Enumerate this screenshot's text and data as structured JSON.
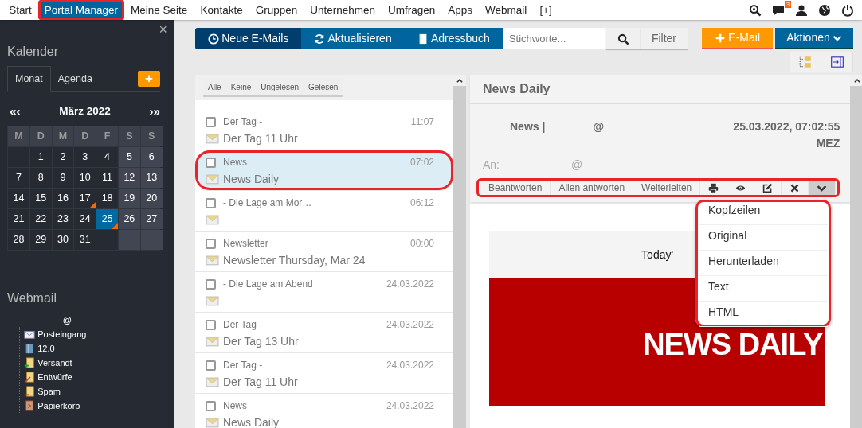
{
  "topnav": {
    "items": [
      {
        "label": "Start",
        "selected": false,
        "highlighted": false
      },
      {
        "label": "Portal Manager",
        "selected": true,
        "highlighted": true
      },
      {
        "label": "Meine Seite",
        "selected": false,
        "highlighted": false
      },
      {
        "label": "Kontakte",
        "selected": false,
        "highlighted": false
      },
      {
        "label": "Gruppen",
        "selected": false,
        "highlighted": false
      },
      {
        "label": "Unternehmen",
        "selected": false,
        "highlighted": false
      },
      {
        "label": "Umfragen",
        "selected": false,
        "highlighted": false
      },
      {
        "label": "Apps",
        "selected": false,
        "highlighted": false
      },
      {
        "label": "Webmail",
        "selected": false,
        "highlighted": false
      },
      {
        "label": "[+]",
        "selected": false,
        "highlighted": false
      }
    ],
    "icons": [
      {
        "kind": "zoom"
      },
      {
        "kind": "chat",
        "badge": "3"
      },
      {
        "kind": "user"
      },
      {
        "kind": "globe"
      },
      {
        "kind": "power"
      }
    ]
  },
  "sidebar": {
    "close": "×",
    "calendar": {
      "title": "Kalender",
      "tabs": [
        {
          "label": "Monat",
          "selected": true
        },
        {
          "label": "Agenda",
          "selected": false
        }
      ],
      "add": "+",
      "prev": "«‹",
      "month": "März 2022",
      "next": "›»",
      "weekdays": [
        "M",
        "D",
        "M",
        "D",
        "F",
        "S",
        "S"
      ],
      "days": [
        {
          "kind": "blank"
        },
        {
          "kind": "day",
          "label": "1",
          "selected": false,
          "marked": false
        },
        {
          "kind": "day",
          "label": "2",
          "selected": false,
          "marked": false
        },
        {
          "kind": "day",
          "label": "3",
          "selected": false,
          "marked": false
        },
        {
          "kind": "day",
          "label": "4",
          "selected": false,
          "marked": false
        },
        {
          "kind": "day",
          "label": "5",
          "selected": false,
          "marked": false
        },
        {
          "kind": "day",
          "label": "6",
          "selected": false,
          "marked": false
        },
        {
          "kind": "day",
          "label": "7",
          "selected": false,
          "marked": false
        },
        {
          "kind": "day",
          "label": "8",
          "selected": false,
          "marked": false
        },
        {
          "kind": "day",
          "label": "9",
          "selected": false,
          "marked": false
        },
        {
          "kind": "day",
          "label": "10",
          "selected": false,
          "marked": false
        },
        {
          "kind": "day",
          "label": "11",
          "selected": false,
          "marked": false
        },
        {
          "kind": "day",
          "label": "12",
          "selected": false,
          "marked": false
        },
        {
          "kind": "day",
          "label": "13",
          "selected": false,
          "marked": false
        },
        {
          "kind": "day",
          "label": "14",
          "selected": false,
          "marked": false
        },
        {
          "kind": "day",
          "label": "15",
          "selected": false,
          "marked": false
        },
        {
          "kind": "day",
          "label": "16",
          "selected": false,
          "marked": false
        },
        {
          "kind": "day",
          "label": "17",
          "selected": false,
          "marked": true
        },
        {
          "kind": "day",
          "label": "18",
          "selected": false,
          "marked": false
        },
        {
          "kind": "day",
          "label": "19",
          "selected": false,
          "marked": false
        },
        {
          "kind": "day",
          "label": "20",
          "selected": false,
          "marked": false
        },
        {
          "kind": "day",
          "label": "21",
          "selected": false,
          "marked": false
        },
        {
          "kind": "day",
          "label": "22",
          "selected": false,
          "marked": false
        },
        {
          "kind": "day",
          "label": "23",
          "selected": false,
          "marked": false
        },
        {
          "kind": "day",
          "label": "24",
          "selected": false,
          "marked": false
        },
        {
          "kind": "day",
          "label": "25",
          "selected": true,
          "marked": true
        },
        {
          "kind": "day",
          "label": "26",
          "selected": false,
          "marked": false
        },
        {
          "kind": "day",
          "label": "27",
          "selected": false,
          "marked": false
        },
        {
          "kind": "day",
          "label": "28",
          "selected": false,
          "marked": false
        },
        {
          "kind": "day",
          "label": "29",
          "selected": false,
          "marked": false
        },
        {
          "kind": "day",
          "label": "30",
          "selected": false,
          "marked": false
        },
        {
          "kind": "day",
          "label": "31",
          "selected": false,
          "marked": false
        },
        {
          "kind": "blank"
        },
        {
          "kind": "blank"
        },
        {
          "kind": "blank"
        }
      ]
    },
    "webmail": {
      "title": "Webmail",
      "account": "@",
      "folders": [
        {
          "label": "Posteingang",
          "kind": "inbox"
        },
        {
          "label": "12.0",
          "kind": "book"
        },
        {
          "label": "Versandt",
          "kind": "sent"
        },
        {
          "label": "Entwürfe",
          "kind": "drafts"
        },
        {
          "label": "Spam",
          "kind": "spam"
        },
        {
          "label": "Papierkorb",
          "kind": "trash"
        }
      ]
    }
  },
  "toolbar": {
    "buttons": [
      {
        "label": "Neue E-Mails",
        "selected": true
      },
      {
        "label": "Aktualisieren",
        "selected": false
      },
      {
        "label": "Adressbuch",
        "selected": false
      }
    ],
    "search": {
      "placeholder": "Stichworte..."
    },
    "filter": "Filter",
    "new_mail": "E-Mail",
    "actions": "Aktionen",
    "view_icons": [
      {
        "kind": "tree"
      },
      {
        "kind": "panel"
      }
    ]
  },
  "mail_list": {
    "filters": [
      "Alle",
      "Keine",
      "Ungelesen",
      "Gelesen"
    ],
    "items": [
      {
        "sender": "Der Tag -",
        "time": "11:07",
        "subject": "Der Tag 11 Uhr",
        "selected": false,
        "highlighted": false
      },
      {
        "sender": "News",
        "time": "07:02",
        "subject": "News Daily",
        "selected": true,
        "highlighted": true
      },
      {
        "sender": "- Die Lage am Mor…",
        "time": "06:12",
        "selected": false,
        "highlighted": false
      },
      {
        "sender": "Newsletter",
        "time": "00:00",
        "subject": "Newsletter Thursday, Mar 24",
        "selected": false,
        "highlighted": false
      },
      {
        "sender": "- Die Lage am Abend",
        "time": "24.03.2022",
        "selected": false,
        "highlighted": false
      },
      {
        "sender": "Der Tag -",
        "time": "24.03.2022",
        "subject": "Der Tag 13 Uhr",
        "selected": false,
        "highlighted": false
      },
      {
        "sender": "Der Tag -",
        "time": "24.03.2022",
        "subject": "Der Tag 11 Uhr",
        "selected": false,
        "highlighted": false
      },
      {
        "sender": "News",
        "time": "24.03.2022",
        "subject": "News Daily",
        "selected": false,
        "highlighted": false
      }
    ]
  },
  "reader": {
    "title": "News Daily",
    "from": "News |",
    "from_address": "@",
    "date": "25.03.2022, 07:02:55 MEZ",
    "to_label": "An:",
    "to_address": "@",
    "actions": {
      "highlighted": true,
      "buttons": [
        {
          "kind": "text",
          "label": "Beantworten"
        },
        {
          "kind": "text",
          "label": "Allen antworten"
        },
        {
          "kind": "text",
          "label": "Weiterleiten"
        },
        {
          "kind": "print"
        },
        {
          "kind": "eye"
        },
        {
          "kind": "edit"
        },
        {
          "kind": "close"
        },
        {
          "kind": "more",
          "expanded": true
        }
      ]
    },
    "menu": {
      "highlighted": true,
      "items": [
        "Kopfzeilen",
        "Original",
        "Herunterladen",
        "Text",
        "HTML"
      ]
    },
    "body": {
      "teaser": "Today'",
      "banner": "NEWS DAILY"
    }
  }
}
